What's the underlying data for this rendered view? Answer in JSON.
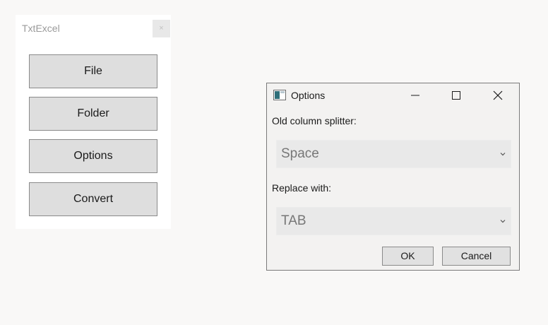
{
  "main_window": {
    "title": "TxtExcel",
    "close_glyph": "×",
    "buttons": [
      "File",
      "Folder",
      "Options",
      "Convert"
    ]
  },
  "options_dialog": {
    "title": "Options",
    "old_splitter_label": "Old column splitter:",
    "old_splitter_value": "Space",
    "replace_label": "Replace with:",
    "replace_value": "TAB",
    "ok_label": "OK",
    "cancel_label": "Cancel"
  },
  "icons": {
    "app": "app-window-icon",
    "minimize": "minimize-icon",
    "maximize": "maximize-icon",
    "close": "close-icon",
    "dropdown": "chevron-down-icon"
  },
  "colors": {
    "background": "#f9f8f7",
    "button_face": "#dedede",
    "combo_face": "#e9e9e9",
    "dialog_face": "#f3f2f1"
  }
}
